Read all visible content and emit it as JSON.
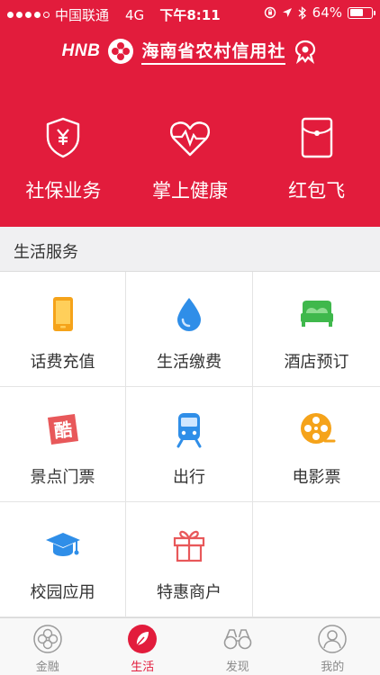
{
  "colors": {
    "brand": "#e21c3c",
    "inactive": "#8a8a8a"
  },
  "status_bar": {
    "carrier": "中国联通",
    "network": "4G",
    "time": "下午8:11",
    "battery": "64%",
    "battery_level": 0.64
  },
  "header": {
    "logo_text": "HNB",
    "bank_name": "海南省农村信用社"
  },
  "quick_actions": [
    {
      "label": "社保业务",
      "icon": "shield-yen-icon"
    },
    {
      "label": "掌上健康",
      "icon": "heart-pulse-icon"
    },
    {
      "label": "红包飞",
      "icon": "red-envelope-icon"
    }
  ],
  "section": {
    "title": "生活服务"
  },
  "services": [
    {
      "label": "话费充值",
      "icon": "phone-icon"
    },
    {
      "label": "生活缴费",
      "icon": "water-drop-icon"
    },
    {
      "label": "酒店预订",
      "icon": "bed-icon"
    },
    {
      "label": "景点门票",
      "icon": "ticket-icon"
    },
    {
      "label": "出行",
      "icon": "train-icon"
    },
    {
      "label": "电影票",
      "icon": "film-reel-icon"
    },
    {
      "label": "校园应用",
      "icon": "graduation-cap-icon"
    },
    {
      "label": "特惠商户",
      "icon": "gift-icon"
    }
  ],
  "tabs": [
    {
      "label": "金融",
      "icon": "finance-icon",
      "active": false
    },
    {
      "label": "生活",
      "icon": "leaf-icon",
      "active": true
    },
    {
      "label": "发现",
      "icon": "binoculars-icon",
      "active": false
    },
    {
      "label": "我的",
      "icon": "profile-icon",
      "active": false
    }
  ]
}
